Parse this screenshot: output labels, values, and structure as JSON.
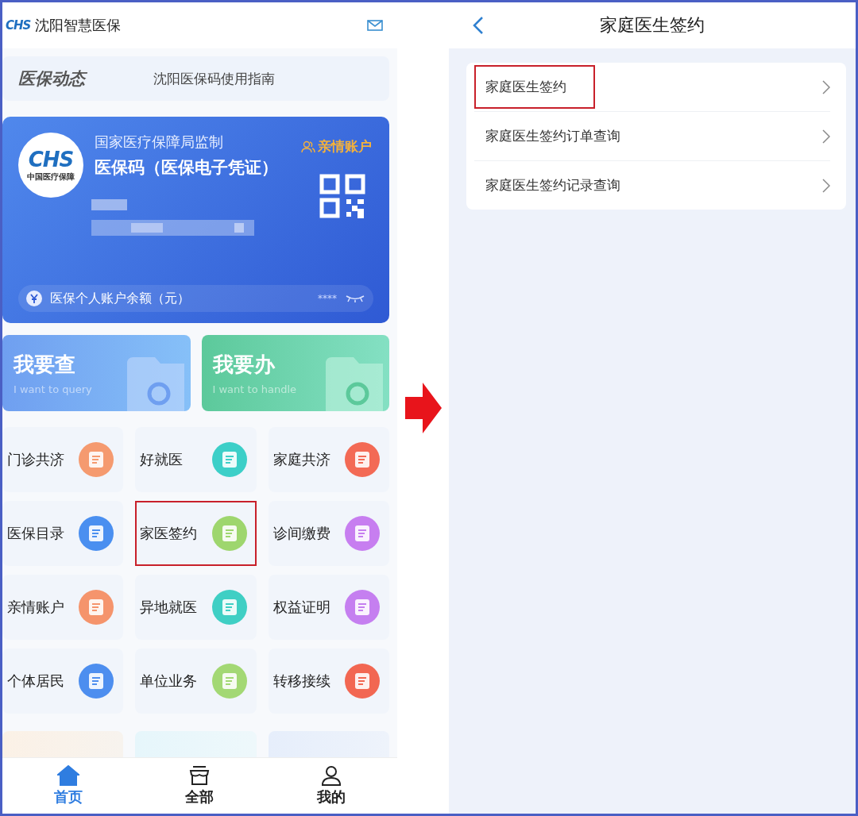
{
  "left_screen": {
    "logo_mark": "CHS",
    "app_title": "沈阳智慧医保",
    "news": {
      "logo_text": "医保动态",
      "headline": "沈阳医保码使用指南"
    },
    "card": {
      "logo_mark": "CHS",
      "logo_caption": "中国医疗保障",
      "issuer": "国家医疗保障局监制",
      "title": "医保码（医保电子凭证）",
      "family_link": "亲情账户",
      "balance_label": "医保个人账户余额（元）",
      "balance_masked": "****"
    },
    "quick_actions": [
      {
        "title": "我要查",
        "subtitle": "I want to query",
        "kind": "query"
      },
      {
        "title": "我要办",
        "subtitle": "I want to handle",
        "kind": "handle"
      }
    ],
    "services": [
      {
        "label": "门诊共济",
        "color": "#f59a6f",
        "highlighted": false
      },
      {
        "label": "好就医",
        "color": "#3ccfc8",
        "highlighted": false
      },
      {
        "label": "家庭共济",
        "color": "#f36a55",
        "highlighted": false
      },
      {
        "label": "医保目录",
        "color": "#4a8ff0",
        "highlighted": false
      },
      {
        "label": "家医签约",
        "color": "#9ed66e",
        "highlighted": true
      },
      {
        "label": "诊间缴费",
        "color": "#c77ef0",
        "highlighted": false
      },
      {
        "label": "亲情账户",
        "color": "#f5946c",
        "highlighted": false
      },
      {
        "label": "异地就医",
        "color": "#3fcfc4",
        "highlighted": false
      },
      {
        "label": "权益证明",
        "color": "#c57ff0",
        "highlighted": false
      },
      {
        "label": "个体居民",
        "color": "#4d8eef",
        "highlighted": false
      },
      {
        "label": "单位业务",
        "color": "#a3d874",
        "highlighted": false
      },
      {
        "label": "转移接续",
        "color": "#f26752",
        "highlighted": false
      }
    ],
    "tabs": [
      {
        "label": "首页",
        "kind": "home",
        "selected": true
      },
      {
        "label": "全部",
        "kind": "all",
        "selected": false
      },
      {
        "label": "我的",
        "kind": "profile",
        "selected": false
      }
    ]
  },
  "right_screen": {
    "title": "家庭医生签约",
    "menu_items": [
      {
        "label": "家庭医生签约",
        "highlighted": true
      },
      {
        "label": "家庭医生签约订单查询",
        "highlighted": false
      },
      {
        "label": "家庭医生签约记录查询",
        "highlighted": false
      }
    ]
  }
}
